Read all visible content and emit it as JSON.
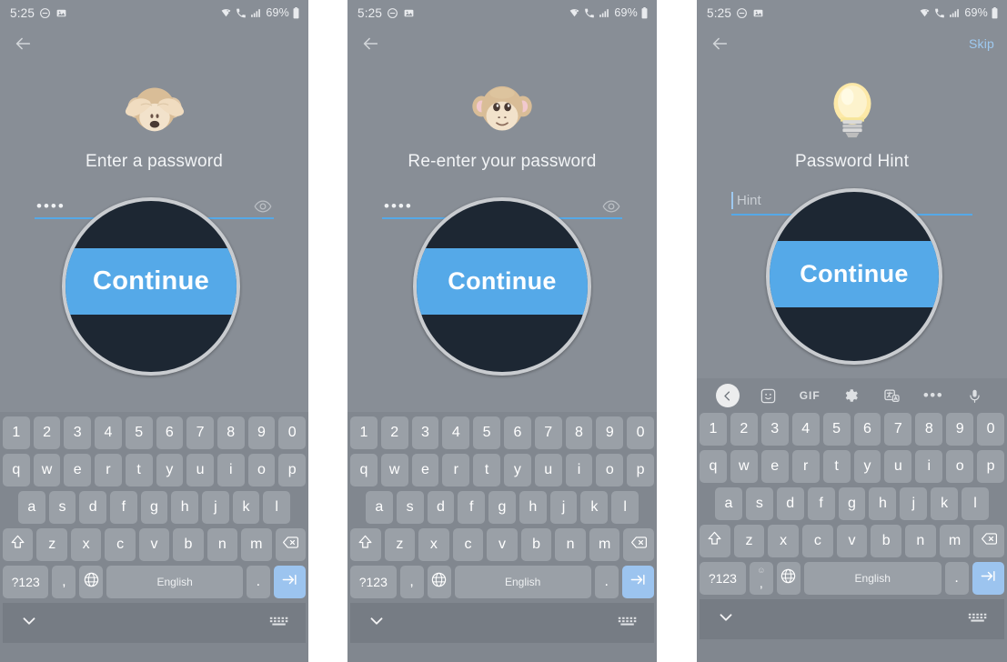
{
  "status_bar": {
    "time": "5:25",
    "battery_text": "69%",
    "icons": [
      "do-not-disturb-icon",
      "image-icon",
      "wifi-icon",
      "volte-call-icon",
      "signal-bars-icon",
      "battery-icon"
    ]
  },
  "magnifier": {
    "label": "Continue",
    "circle_bg": "#1d2733",
    "band_color": "#55a9e8",
    "ring_color": "#c9ccd0"
  },
  "theme": {
    "screen_bg": "#888e96",
    "keyboard_bg": "#81878f",
    "key_bg": "#9aa0a7",
    "accent_blue": "#55a9e8",
    "enter_key_bg": "#9cc4ef",
    "nav_bg": "#767c84",
    "link_blue": "#9ec9f0"
  },
  "panels": [
    {
      "id": "enter-password",
      "emoji": "see-no-evil-monkey",
      "title": "Enter a password",
      "field": {
        "type": "password",
        "value": "••••",
        "trailing_icon": "eye-icon"
      },
      "skip_label": "",
      "has_skip": false,
      "has_kb_toolbar": false
    },
    {
      "id": "re-enter-password",
      "emoji": "monkey-face",
      "title": "Re-enter your password",
      "field": {
        "type": "password",
        "value": "••••",
        "trailing_icon": "eye-icon"
      },
      "skip_label": "",
      "has_skip": false,
      "has_kb_toolbar": false
    },
    {
      "id": "password-hint",
      "emoji": "light-bulb",
      "title": "Password Hint",
      "field": {
        "type": "text",
        "value": "",
        "placeholder": "Hint",
        "trailing_icon": ""
      },
      "skip_label": "Skip",
      "has_skip": true,
      "has_kb_toolbar": true
    }
  ],
  "keyboard": {
    "toolbar": [
      {
        "name": "keyboard-back-button",
        "label": ""
      },
      {
        "name": "sticker-icon",
        "label": ""
      },
      {
        "name": "gif-icon",
        "label": "GIF"
      },
      {
        "name": "settings-gear-icon",
        "label": ""
      },
      {
        "name": "translate-icon",
        "label": ""
      },
      {
        "name": "more-options-icon",
        "label": "•••"
      },
      {
        "name": "microphone-icon",
        "label": ""
      }
    ],
    "row_numbers": [
      "1",
      "2",
      "3",
      "4",
      "5",
      "6",
      "7",
      "8",
      "9",
      "0"
    ],
    "row_top": [
      "q",
      "w",
      "e",
      "r",
      "t",
      "y",
      "u",
      "i",
      "o",
      "p"
    ],
    "row_home": [
      "a",
      "s",
      "d",
      "f",
      "g",
      "h",
      "j",
      "k",
      "l"
    ],
    "row_bottom": [
      "z",
      "x",
      "c",
      "v",
      "b",
      "n",
      "m"
    ],
    "shift_key": "shift-icon",
    "backspace_key": "backspace-icon",
    "symbols_key": "?123",
    "comma_key": ",",
    "comma_sub_emoji": "☺",
    "globe_key": "globe-icon",
    "space_key": "English",
    "period_key": ".",
    "enter_key": "tab-next-icon"
  },
  "nav_bar": {
    "hide_keyboard": "chevron-down-icon",
    "keyboard_switch": "keyboard-layout-icon"
  }
}
